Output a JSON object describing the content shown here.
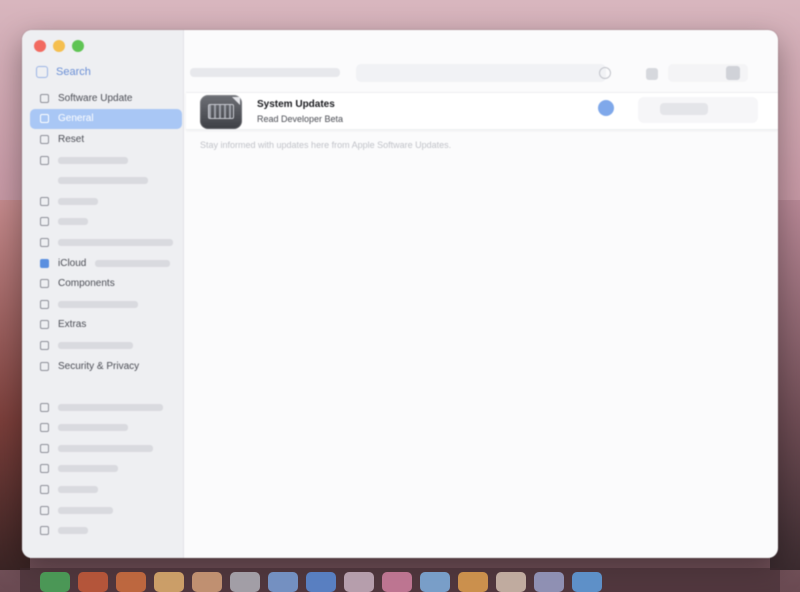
{
  "window": {
    "title": ""
  },
  "sidebar": {
    "search_label": "Search",
    "items": [
      {
        "label": "Software Update",
        "icon": "gear-icon",
        "selected": false
      },
      {
        "label": "General",
        "icon": "gear-icon",
        "selected": true
      },
      {
        "label": "Reset",
        "icon": "reset-icon",
        "selected": false
      }
    ],
    "lower_items": [
      {
        "label": "iCloud",
        "icon": "cloud-icon",
        "blue": true
      },
      {
        "label": "Components",
        "icon": "components-icon",
        "blue": false
      },
      {
        "label": "Extras",
        "icon": "extras-icon",
        "blue": false
      },
      {
        "label": "Security & Privacy",
        "icon": "lock-icon",
        "blue": false
      }
    ]
  },
  "update": {
    "title": "System Updates",
    "subtitle": "Read Developer Beta",
    "hint": "Stay informed with updates here from Apple Software Updates."
  },
  "colors": {
    "accent": "#a9c7f5",
    "toggle": "#7fa8ea"
  }
}
